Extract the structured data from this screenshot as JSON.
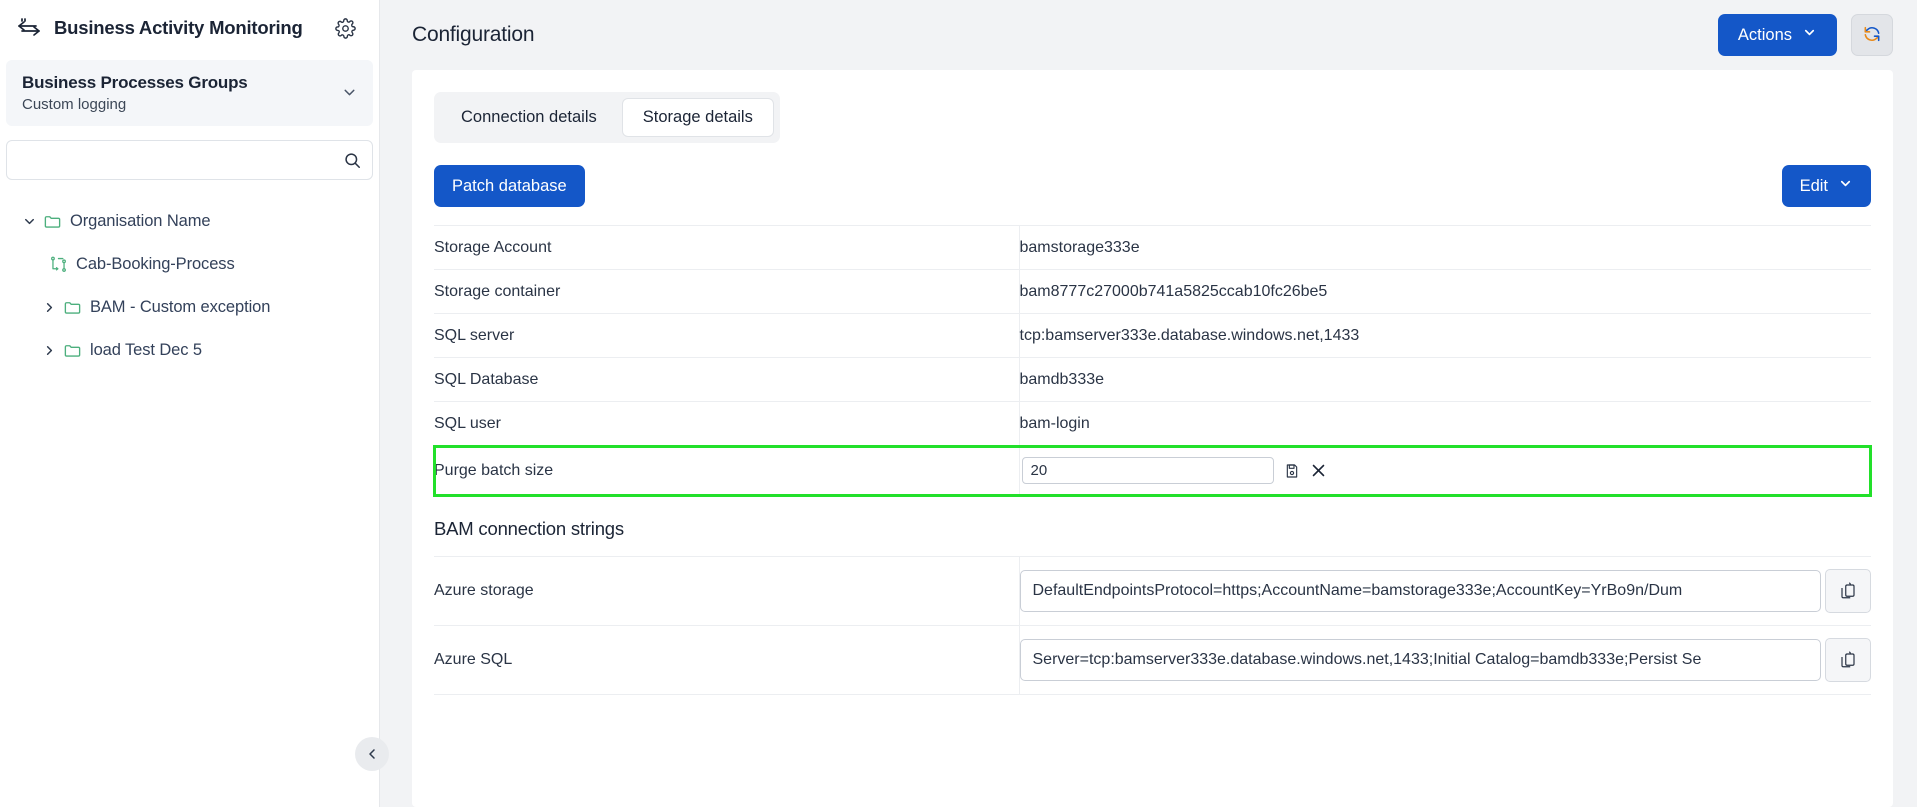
{
  "sidebar": {
    "brand_title": "Business Activity Monitoring",
    "brand_icon": "bam-logo-icon",
    "settings_icon": "gear-icon",
    "group": {
      "title": "Business Processes Groups",
      "subtitle": "Custom logging",
      "chevron_icon": "chevron-down-icon"
    },
    "search": {
      "value": "",
      "placeholder": "",
      "icon": "search-icon"
    },
    "tree": [
      {
        "label": "Organisation Name",
        "icon": "folder-icon",
        "caret": "chevron-down-icon",
        "expanded": true,
        "depth": 1
      },
      {
        "label": "Cab-Booking-Process",
        "icon": "process-icon",
        "caret": "",
        "expanded": false,
        "depth": 2
      },
      {
        "label": "BAM - Custom exception",
        "icon": "folder-icon",
        "caret": "chevron-right-icon",
        "expanded": false,
        "depth": 1
      },
      {
        "label": "load Test Dec 5",
        "icon": "folder-icon",
        "caret": "chevron-right-icon",
        "expanded": false,
        "depth": 1
      }
    ],
    "collapse_icon": "chevron-left-icon"
  },
  "header": {
    "title": "Configuration",
    "actions_label": "Actions",
    "actions_chevron": "chevron-down-icon",
    "refresh_icon": "refresh-icon"
  },
  "tabs": [
    {
      "label": "Connection details",
      "active": false
    },
    {
      "label": "Storage details",
      "active": true
    }
  ],
  "toolbar": {
    "patch_label": "Patch database",
    "edit_label": "Edit",
    "edit_chevron": "chevron-down-icon"
  },
  "config_table": {
    "rows": [
      {
        "key": "Storage Account",
        "value": "bamstorage333e",
        "type": "text"
      },
      {
        "key": "Storage container",
        "value": "bam8777c27000b741a5825ccab10fc26be5",
        "type": "text"
      },
      {
        "key": "SQL server",
        "value": "tcp:bamserver333e.database.windows.net,1433",
        "type": "text"
      },
      {
        "key": "SQL Database",
        "value": "bamdb333e",
        "type": "text"
      },
      {
        "key": "SQL user",
        "value": "bam-login",
        "type": "text"
      }
    ],
    "edit_row": {
      "key": "Purge batch size",
      "value": "20",
      "placeholder": "",
      "save_icon": "save-icon",
      "cancel_icon": "close-icon",
      "highlight_color": "#22e02a"
    }
  },
  "connection_strings": {
    "section_title": "BAM connection strings",
    "rows": [
      {
        "key": "Azure storage",
        "value": "DefaultEndpointsProtocol=https;AccountName=bamstorage333e;AccountKey=YrBo9n/Dum",
        "copy_icon": "copy-icon"
      },
      {
        "key": "Azure SQL",
        "value": "Server=tcp:bamserver333e.database.windows.net,1433;Initial Catalog=bamdb333e;Persist Se",
        "copy_icon": "copy-icon"
      }
    ]
  },
  "colors": {
    "primary": "#1457c8",
    "highlight": "#22e02a",
    "folder_green": "#4caf7d",
    "text": "#1b2435",
    "panel_bg": "#f2f3f5"
  }
}
